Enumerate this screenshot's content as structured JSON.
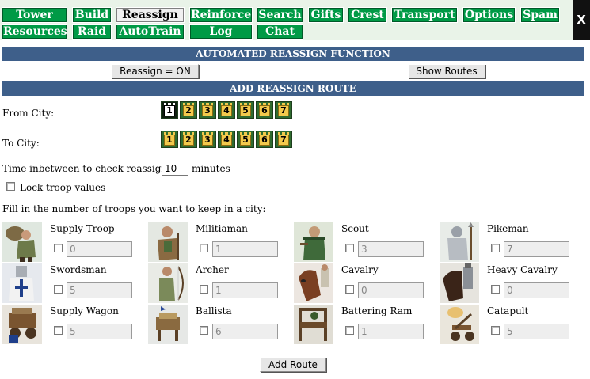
{
  "nav": {
    "tabs": [
      {
        "label": "Tower"
      },
      {
        "label": "Build"
      },
      {
        "label": "Reassign",
        "active": true
      },
      {
        "label": "Reinforce"
      },
      {
        "label": "Search"
      },
      {
        "label": "Gifts"
      },
      {
        "label": "Crest"
      },
      {
        "label": "Transport"
      },
      {
        "label": "Options"
      },
      {
        "label": "Spam"
      },
      {
        "label": "Resources"
      },
      {
        "label": "Raid"
      },
      {
        "label": "AutoTrain"
      },
      {
        "label": "Log"
      },
      {
        "label": "Chat"
      }
    ],
    "close_label": "X"
  },
  "automated": {
    "header": "AUTOMATED REASSIGN FUNCTION",
    "toggle_label": "Reassign = ON",
    "show_routes_label": "Show Routes"
  },
  "add_route": {
    "header": "ADD REASSIGN ROUTE",
    "from_label": "From City:",
    "to_label": "To City:",
    "cities": [
      "1",
      "2",
      "3",
      "4",
      "5",
      "6",
      "7"
    ],
    "from_selected": "1",
    "interval_label": "Time inbetween to check reassign:",
    "interval_value": "10",
    "interval_unit": "minutes",
    "lock_label": "Lock troop values",
    "instruction": "Fill in the number of troops you want to keep in a city:",
    "add_button_label": "Add Route"
  },
  "troops": [
    {
      "name": "Supply Troop",
      "value": "0",
      "icon": "supply-troop-portrait"
    },
    {
      "name": "Militiaman",
      "value": "1",
      "icon": "militiaman-portrait"
    },
    {
      "name": "Scout",
      "value": "3",
      "icon": "scout-portrait"
    },
    {
      "name": "Pikeman",
      "value": "7",
      "icon": "pikeman-portrait"
    },
    {
      "name": "Swordsman",
      "value": "5",
      "icon": "swordsman-portrait"
    },
    {
      "name": "Archer",
      "value": "1",
      "icon": "archer-portrait"
    },
    {
      "name": "Cavalry",
      "value": "0",
      "icon": "cavalry-portrait"
    },
    {
      "name": "Heavy Cavalry",
      "value": "0",
      "icon": "heavy-cavalry-portrait"
    },
    {
      "name": "Supply Wagon",
      "value": "5",
      "icon": "supply-wagon-portrait"
    },
    {
      "name": "Ballista",
      "value": "6",
      "icon": "ballista-portrait"
    },
    {
      "name": "Battering Ram",
      "value": "1",
      "icon": "battering-ram-portrait"
    },
    {
      "name": "Catapult",
      "value": "5",
      "icon": "catapult-portrait"
    }
  ],
  "colors": {
    "tab_green": "#009a46",
    "section_blue": "#3e5f8a",
    "city_green": "#2f6b2f",
    "city_gold": "#f2c94c"
  }
}
